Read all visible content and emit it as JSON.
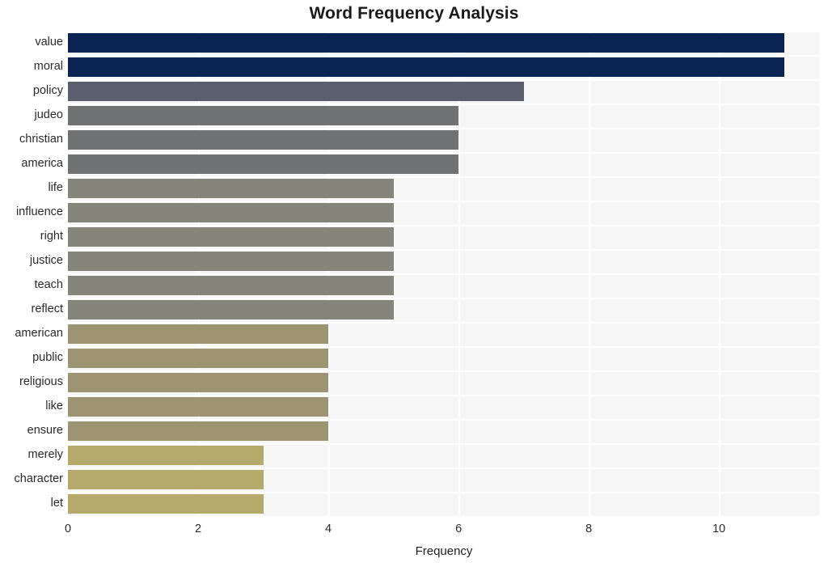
{
  "chart": {
    "title": "Word Frequency Analysis",
    "xlabel": "Frequency",
    "ylabel": ""
  },
  "chart_data": {
    "type": "bar",
    "orientation": "horizontal",
    "title": "Word Frequency Analysis",
    "xlabel": "Frequency",
    "ylabel": "",
    "categories": [
      "value",
      "moral",
      "policy",
      "judeo",
      "christian",
      "america",
      "life",
      "influence",
      "right",
      "justice",
      "teach",
      "reflect",
      "american",
      "public",
      "religious",
      "like",
      "ensure",
      "merely",
      "character",
      "let"
    ],
    "values": [
      11,
      11,
      7,
      6,
      6,
      6,
      5,
      5,
      5,
      5,
      5,
      5,
      4,
      4,
      4,
      4,
      4,
      3,
      3,
      3
    ],
    "bar_colors": [
      "#0a2352",
      "#0a2352",
      "#5a5e6e",
      "#717274",
      "#717274",
      "#717274",
      "#858579",
      "#858579",
      "#858579",
      "#858579",
      "#858579",
      "#858579",
      "#9c9472",
      "#9c9472",
      "#9c9472",
      "#9c9472",
      "#9c9472",
      "#b5aa6c",
      "#b5aa6c",
      "#b5aa6c"
    ],
    "xlim": [
      0,
      11.55
    ],
    "xticks": [
      0,
      2,
      4,
      6,
      8,
      10
    ],
    "xtick_labels": [
      "0",
      "2",
      "4",
      "6",
      "8",
      "10"
    ],
    "grid": true,
    "grid_color": "#ffffff",
    "plot_background": "#f6f6f7",
    "figure_background": "#ffffff",
    "legend": null
  }
}
